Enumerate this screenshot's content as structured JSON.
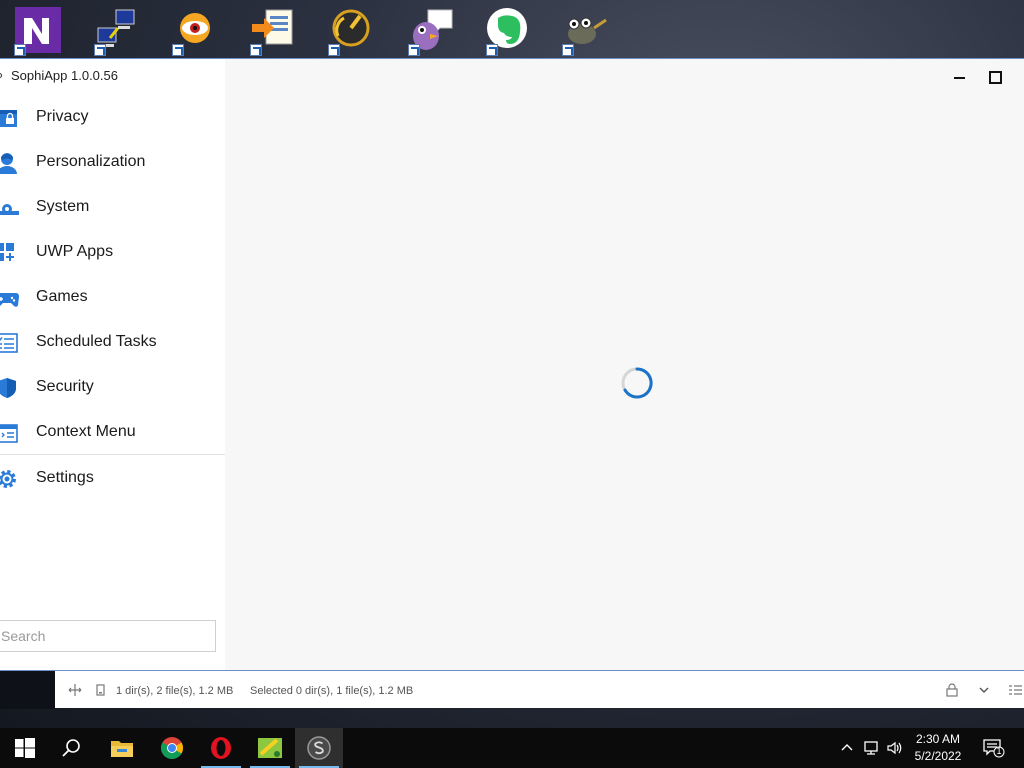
{
  "app": {
    "title": "SophiApp 1.0.0.56",
    "nav": [
      {
        "label": "Privacy",
        "icon": "privacy-icon"
      },
      {
        "label": "Personalization",
        "icon": "personalization-icon"
      },
      {
        "label": "System",
        "icon": "system-icon"
      },
      {
        "label": "UWP Apps",
        "icon": "uwp-apps-icon"
      },
      {
        "label": "Games",
        "icon": "gamepad-icon"
      },
      {
        "label": "Scheduled Tasks",
        "icon": "scheduled-tasks-icon"
      },
      {
        "label": "Security",
        "icon": "shield-icon"
      },
      {
        "label": "Context Menu",
        "icon": "context-menu-icon"
      },
      {
        "label": "Settings",
        "icon": "gear-icon"
      }
    ],
    "search": {
      "placeholder": "Search",
      "value": ""
    },
    "accent": "#1a73c8"
  },
  "statusbar": {
    "dir_info": "1 dir(s), 2 file(s), 1.2 MB",
    "selected_info": "Selected 0 dir(s), 1 file(s), 1.2 MB"
  },
  "taskbar": {
    "time": "2:30 AM",
    "date": "5/2/2022",
    "notification_count": "1"
  }
}
